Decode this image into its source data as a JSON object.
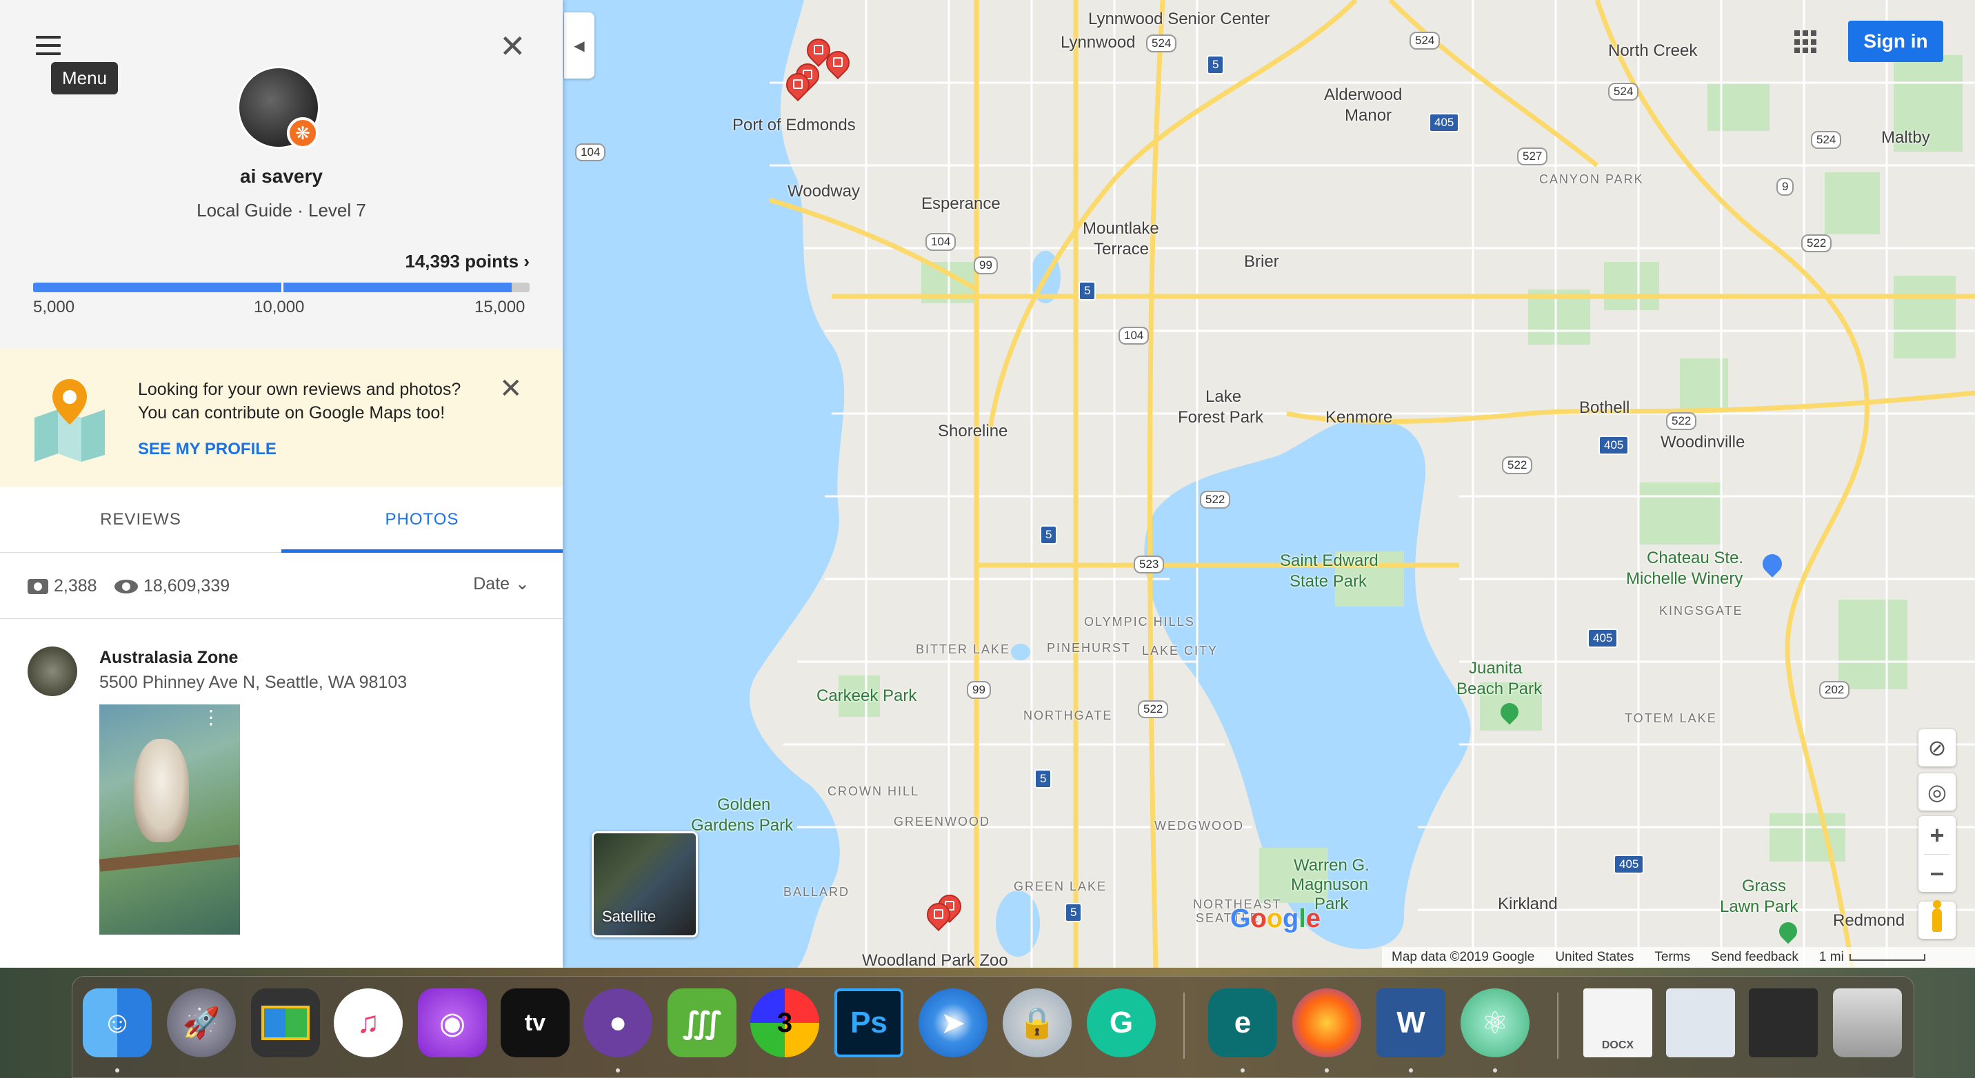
{
  "sidebar": {
    "tooltip": "Menu",
    "user_name": "ai savery",
    "user_level": "Local Guide · Level 7",
    "points_label": "14,393 points",
    "points_chevron": "›",
    "progress_fraction": 0.964,
    "ticks": [
      "5,000",
      "10,000",
      "15,000"
    ],
    "promo": {
      "line1": "Looking for your own reviews and photos?",
      "line2": "You can contribute on Google Maps too!",
      "link": "SEE MY PROFILE"
    },
    "tabs": [
      "REVIEWS",
      "PHOTOS"
    ],
    "active_tab": "PHOTOS",
    "stats": {
      "photos_count": "2,388",
      "views_count": "18,609,339",
      "sort_label": "Date"
    },
    "entry": {
      "title": "Australasia Zone",
      "address": "5500 Phinney Ave N, Seattle, WA 98103"
    }
  },
  "map": {
    "signin_label": "Sign in",
    "satellite_label": "Satellite",
    "google_logo": [
      "G",
      "o",
      "o",
      "g",
      "l",
      "e"
    ],
    "attribution": {
      "map_data": "Map data ©2019 Google",
      "region": "United States",
      "terms": "Terms",
      "feedback": "Send feedback",
      "scale": "1 mi"
    },
    "places": {
      "lynnwood_senior": "Lynnwood Senior Center",
      "lynnwood": "Lynnwood",
      "north_creek": "North Creek",
      "maltby": "Maltby",
      "port_edmonds": "Port of Edmonds",
      "alderwood": "Alderwood",
      "manor": "Manor",
      "woodway": "Woodway",
      "esperance": "Esperance",
      "mountlake": "Mountlake",
      "terrace": "Terrace",
      "brier": "Brier",
      "canyon_park": "CANYON PARK",
      "shoreline": "Shoreline",
      "lake": "Lake",
      "forest_park": "Forest Park",
      "kenmore": "Kenmore",
      "bothell": "Bothell",
      "woodinville": "Woodinville",
      "saint_edward": "Saint Edward",
      "state_park": "State Park",
      "chateau": "Chateau Ste.",
      "michelle": "Michelle Winery",
      "kingsgate": "KINGSGATE",
      "olympic_hills": "OLYMPIC HILLS",
      "bitter_lake": "BITTER LAKE",
      "pinehurst": "PINEHURST",
      "lake_city": "LAKE CITY",
      "carkeek": "Carkeek Park",
      "juanita": "Juanita",
      "beach_park": "Beach Park",
      "totem_lake": "TOTEM LAKE",
      "northgate": "NORTHGATE",
      "crown_hill": "CROWN HILL",
      "greenwood": "GREENWOOD",
      "wedgwood": "WEDGWOOD",
      "golden": "Golden",
      "gardens_park": "Gardens Park",
      "warren1": "Warren G.",
      "warren2": "Magnuson",
      "warren3": "Park",
      "ballard": "BALLARD",
      "green_lake": "GREEN LAKE",
      "ne_seattle1": "NORTHEAST",
      "ne_seattle2": "SEATTLE",
      "kirkland": "Kirkland",
      "grass1": "Grass",
      "grass2": "Lawn Park",
      "redmond": "Redmond",
      "woodland": "Woodland Park Zoo"
    },
    "shields": {
      "s524a": "524",
      "s524b": "524",
      "s524c": "524",
      "s524d": "524",
      "s5a": "5",
      "s405a": "405",
      "s104a": "104",
      "s527": "527",
      "s9": "9",
      "s104b": "104",
      "s99a": "99",
      "s522a": "522",
      "s5b": "5",
      "s104c": "104",
      "s522b": "522",
      "s405b": "405",
      "s522c": "522",
      "s522d": "522",
      "s5c": "5",
      "s523": "523",
      "s405c": "405",
      "s99b": "99",
      "s522e": "522",
      "s202": "202",
      "s5d": "5",
      "s405d": "405",
      "s5e": "5"
    }
  },
  "dock": {
    "apps": [
      "finder-icon",
      "launchpad-icon",
      "image-capture-icon",
      "itunes-icon",
      "podcasts-icon",
      "apple-tv-icon",
      "github-desktop-icon",
      "camtasia-icon",
      "k3-icon",
      "photoshop-icon",
      "safari-icon",
      "keychain-icon",
      "grammarly-icon",
      "eset-icon",
      "firefox-icon",
      "word-icon",
      "atom-icon",
      "docx-file-icon",
      "browser-window-icon",
      "photoshop-window-icon",
      "trash-icon"
    ],
    "labels": {
      "appletv": "tv",
      "photoshop": "Ps",
      "word": "W",
      "k3": "3",
      "eset": "e",
      "grammarly": "G",
      "docx": "DOCX"
    }
  },
  "colors": {
    "accent": "#1a73e8",
    "water": "#aadaff",
    "park": "#c8e6c0",
    "pin": "#e8453c",
    "promo_bg": "#fef7e0"
  }
}
